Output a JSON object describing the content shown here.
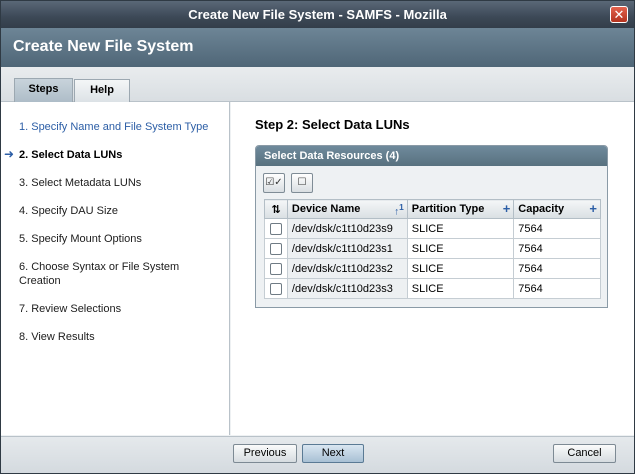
{
  "window": {
    "title": "Create New File System - SAMFS - Mozilla",
    "close_icon": "close-icon"
  },
  "header": {
    "title": "Create New File System"
  },
  "tabs": [
    {
      "label": "Steps",
      "active": true
    },
    {
      "label": "Help",
      "active": false
    }
  ],
  "steps": [
    {
      "label": "1. Specify Name and File System Type",
      "state": "link"
    },
    {
      "label": "2. Select Data LUNs",
      "state": "current"
    },
    {
      "label": "3. Select Metadata LUNs",
      "state": "normal"
    },
    {
      "label": "4. Specify DAU Size",
      "state": "normal"
    },
    {
      "label": "5. Specify Mount Options",
      "state": "normal"
    },
    {
      "label": "6. Choose Syntax or File System Creation",
      "state": "normal"
    },
    {
      "label": "7. Review Selections",
      "state": "normal"
    },
    {
      "label": "8. View Results",
      "state": "normal"
    }
  ],
  "content": {
    "title": "Step 2:  Select Data LUNs",
    "panel_title": "Select Data Resources (4)",
    "table": {
      "columns": [
        "Device Name",
        "Partition Type",
        "Capacity"
      ],
      "sort_order": "1",
      "rows": [
        {
          "device": "/dev/dsk/c1t10d23s9",
          "partition": "SLICE",
          "capacity": "7564"
        },
        {
          "device": "/dev/dsk/c1t10d23s1",
          "partition": "SLICE",
          "capacity": "7564"
        },
        {
          "device": "/dev/dsk/c1t10d23s2",
          "partition": "SLICE",
          "capacity": "7564"
        },
        {
          "device": "/dev/dsk/c1t10d23s3",
          "partition": "SLICE",
          "capacity": "7564"
        }
      ]
    }
  },
  "footer": {
    "previous": "Previous",
    "next": "Next",
    "cancel": "Cancel"
  },
  "colors": {
    "link": "#2c5ea6",
    "header": "#58717f"
  }
}
